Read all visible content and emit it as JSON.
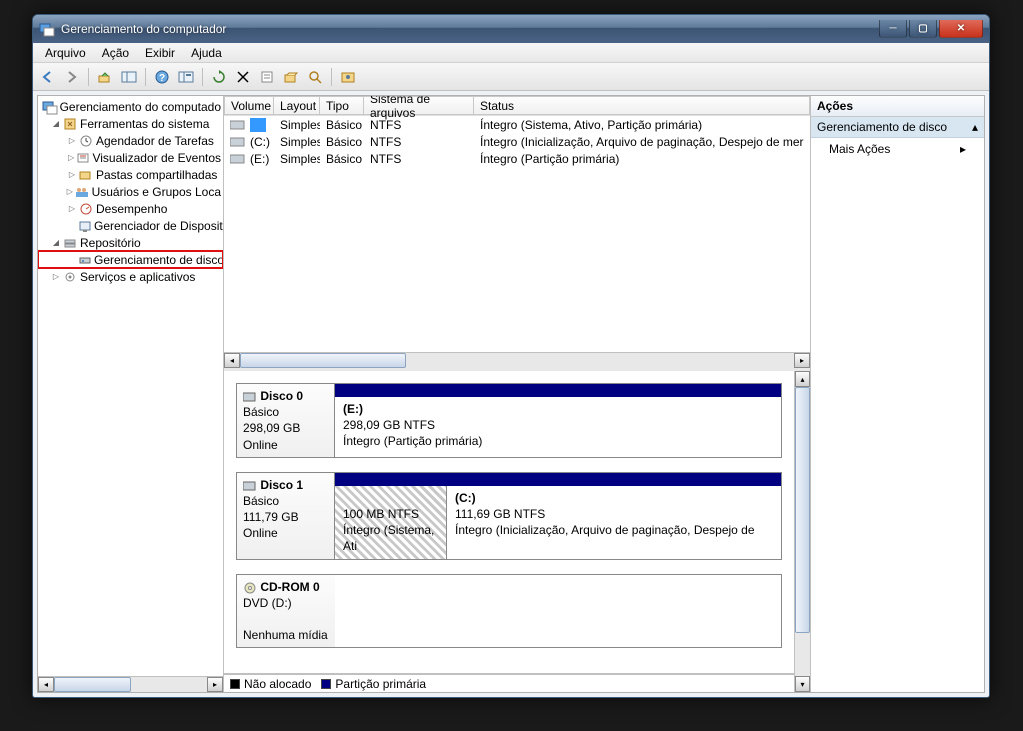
{
  "window_title": "Gerenciamento do computador",
  "menu": [
    "Arquivo",
    "Ação",
    "Exibir",
    "Ajuda"
  ],
  "tree": {
    "root": "Gerenciamento do computado",
    "system_tools": "Ferramentas do sistema",
    "task_scheduler": "Agendador de Tarefas",
    "event_viewer": "Visualizador de Eventos",
    "shared_folders": "Pastas compartilhadas",
    "users_groups": "Usuários e Grupos Loca",
    "performance": "Desempenho",
    "device_mgr": "Gerenciador de Dispositi",
    "storage": "Repositório",
    "disk_mgmt": "Gerenciamento de disco",
    "services": "Serviços e aplicativos"
  },
  "vol_headers": {
    "volume": "Volume",
    "layout": "Layout",
    "type": "Tipo",
    "fs": "Sistema de arquivos",
    "status": "Status"
  },
  "volumes": [
    {
      "name": "",
      "layout": "Simples",
      "type": "Básico",
      "fs": "NTFS",
      "status": "Íntegro (Sistema, Ativo, Partição primária)",
      "selected": true
    },
    {
      "name": "(C:)",
      "layout": "Simples",
      "type": "Básico",
      "fs": "NTFS",
      "status": "Íntegro (Inicialização, Arquivo de paginação, Despejo de mer"
    },
    {
      "name": "(E:)",
      "layout": "Simples",
      "type": "Básico",
      "fs": "NTFS",
      "status": "Íntegro (Partição primária)"
    }
  ],
  "disks": {
    "d0": {
      "name": "Disco 0",
      "type": "Básico",
      "size": "298,09 GB",
      "state": "Online",
      "p1_name": "(E:)",
      "p1_size": "298,09 GB NTFS",
      "p1_status": "Íntegro (Partição primária)"
    },
    "d1": {
      "name": "Disco 1",
      "type": "Básico",
      "size": "111,79 GB",
      "state": "Online",
      "p1_size": "100 MB NTFS",
      "p1_status": "Íntegro (Sistema, Ati",
      "p2_name": "(C:)",
      "p2_size": "111,69 GB NTFS",
      "p2_status": "Íntegro (Inicialização, Arquivo de paginação, Despejo de"
    },
    "cd": {
      "name": "CD-ROM 0",
      "type": "DVD (D:)",
      "state": "Nenhuma mídia"
    }
  },
  "legend": {
    "unalloc": "Não alocado",
    "primary": "Partição primária"
  },
  "actions": {
    "header": "Ações",
    "group": "Gerenciamento de disco",
    "more": "Mais Ações"
  }
}
